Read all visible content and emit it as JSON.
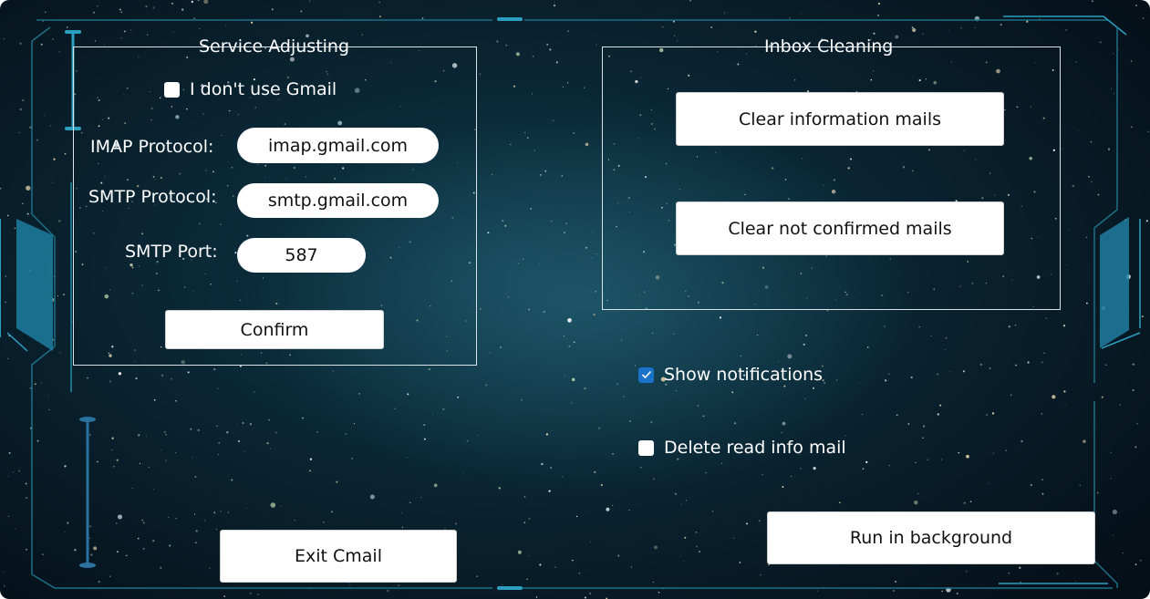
{
  "service": {
    "title": "Service Adjusting",
    "no_gmail_label": "I don't use Gmail",
    "no_gmail_checked": false,
    "imap_label": "IMAP Protocol:",
    "imap_value": "imap.gmail.com",
    "smtp_label": "SMTP Protocol:",
    "smtp_value": "smtp.gmail.com",
    "port_label": "SMTP Port:",
    "port_value": "587",
    "confirm_label": "Confirm"
  },
  "inbox": {
    "title": "Inbox Cleaning",
    "clear_info_label": "Clear information mails",
    "clear_unconfirmed_label": "Clear not confirmed mails"
  },
  "options": {
    "show_notifications_label": "Show notifications",
    "show_notifications_checked": true,
    "delete_read_label": "Delete read info mail",
    "delete_read_checked": false
  },
  "footer": {
    "exit_label": "Exit Cmail",
    "background_label": "Run in background"
  },
  "colors": {
    "accent": "#1a73c8",
    "frame": "#2a9fc0",
    "background": "#0a2533"
  }
}
